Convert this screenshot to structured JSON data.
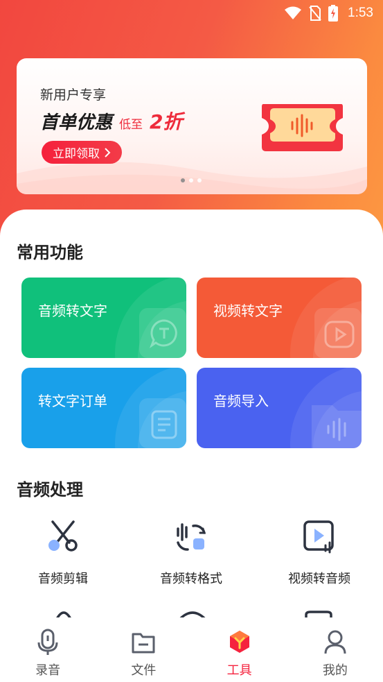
{
  "status": {
    "time": "1:53"
  },
  "banner": {
    "kicker": "新用户专享",
    "headline": "首单优惠",
    "discount_prefix": "低至",
    "discount_value": "2折",
    "cta_label": "立即领取",
    "cta_icon": "chevron-right-icon",
    "page_count": 3,
    "active_page": 1
  },
  "common": {
    "title": "常用功能",
    "cards": [
      {
        "label": "音频转文字",
        "icon": "speech-bubble-t-icon",
        "color": "#10c07b"
      },
      {
        "label": "视频转文字",
        "icon": "play-icon",
        "color": "#f45a37"
      },
      {
        "label": "转文字订单",
        "icon": "document-icon",
        "color": "#19a0ea"
      },
      {
        "label": "音频导入",
        "icon": "folder-waveform-icon",
        "color": "#4a62f0"
      }
    ]
  },
  "audio": {
    "title": "音频处理",
    "tools": [
      {
        "label": "音频剪辑",
        "icon": "scissors-icon"
      },
      {
        "label": "音频转格式",
        "icon": "convert-format-icon"
      },
      {
        "label": "视频转音频",
        "icon": "video-to-audio-icon"
      }
    ]
  },
  "tabbar": {
    "tabs": [
      {
        "label": "录音",
        "icon": "microphone-icon"
      },
      {
        "label": "文件",
        "icon": "folder-icon"
      },
      {
        "label": "工具",
        "icon": "tools-cube-icon",
        "active": true
      },
      {
        "label": "我的",
        "icon": "user-icon"
      }
    ]
  },
  "colors": {
    "accent": "#f5233e",
    "header_start": "#f2473f",
    "header_end": "#fd9b42"
  }
}
